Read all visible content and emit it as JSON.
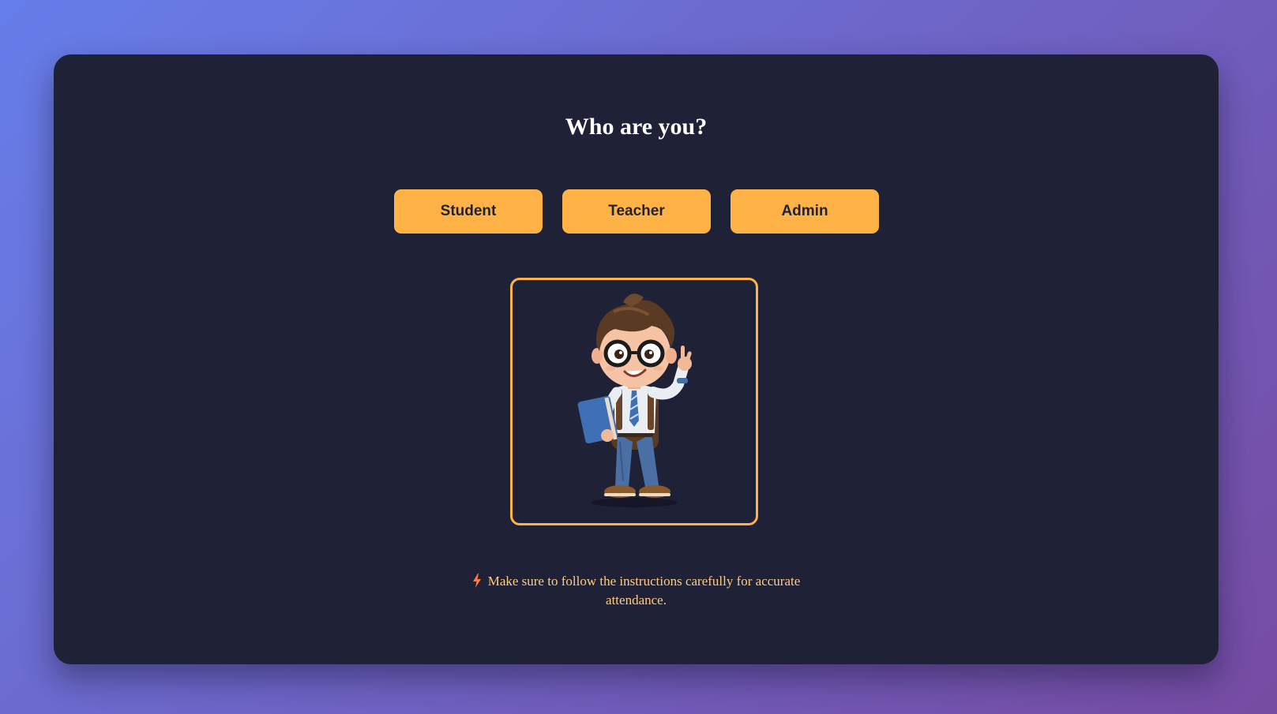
{
  "page": {
    "title": "Who are you?"
  },
  "roles": [
    {
      "label": "Student"
    },
    {
      "label": "Teacher"
    },
    {
      "label": "Admin"
    }
  ],
  "avatar": {
    "icon": "student-character-illustration"
  },
  "notice": {
    "icon": "lightning-bolt-icon",
    "text": "Make sure to follow the instructions carefully for accurate attendance."
  },
  "colors": {
    "background_gradient_start": "#667eea",
    "background_gradient_end": "#764ba2",
    "card": "#1f2237",
    "accent": "#ffb347",
    "notice_text": "#ffcc80",
    "bolt": "#ff7a45"
  }
}
